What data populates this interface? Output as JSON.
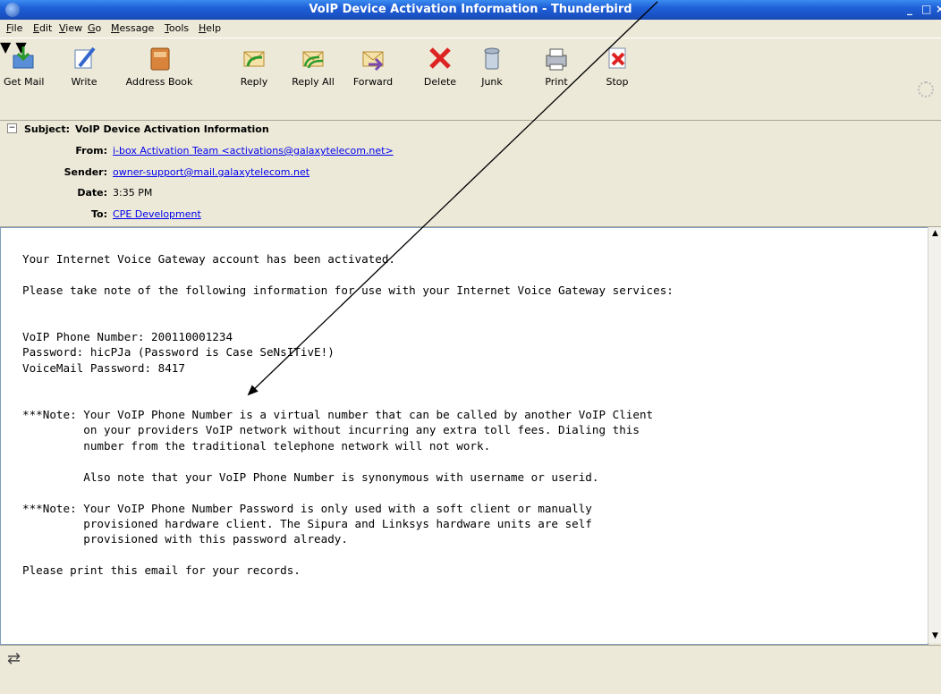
{
  "window": {
    "title": "VoIP Device Activation Information - Thunderbird",
    "min": "_",
    "max": "□",
    "close": "×"
  },
  "menu": [
    "File",
    "Edit",
    "View",
    "Go",
    "Message",
    "Tools",
    "Help"
  ],
  "toolbar": {
    "get_mail": "Get Mail",
    "write": "Write",
    "address_book": "Address Book",
    "reply": "Reply",
    "reply_all": "Reply All",
    "forward": "Forward",
    "delete": "Delete",
    "junk": "Junk",
    "print": "Print",
    "stop": "Stop"
  },
  "header": {
    "subject_label": "Subject:",
    "subject": "VoIP Device Activation Information",
    "from_label": "From:",
    "from": "i-box Activation Team <activations@galaxytelecom.net>",
    "sender_label": "Sender:",
    "sender": "owner-support@mail.galaxytelecom.net",
    "date_label": "Date:",
    "date": "3:35 PM",
    "to_label": "To:",
    "to": "CPE Development"
  },
  "message": {
    "body": "Your Internet Voice Gateway account has been activated.\n\nPlease take note of the following information for use with your Internet Voice Gateway services:\n\n\nVoIP Phone Number: 200110001234\nPassword: hicPJa (Password is Case SeNsITivE!)\nVoiceMail Password: 8417\n\n\n***Note: Your VoIP Phone Number is a virtual number that can be called by another VoIP Client\n         on your providers VoIP network without incurring any extra toll fees. Dialing this\n         number from the traditional telephone network will not work.\n\n         Also note that your VoIP Phone Number is synonymous with username or userid.\n\n***Note: Your VoIP Phone Number Password is only used with a soft client or manually\n         provisioned hardware client. The Sipura and Linksys hardware units are self\n         provisioned with this password already.\n\nPlease print this email for your records."
  },
  "colors": {
    "title_bar": "#1f5fd8",
    "link": "#0000ee",
    "chrome": "#ece9d8"
  }
}
